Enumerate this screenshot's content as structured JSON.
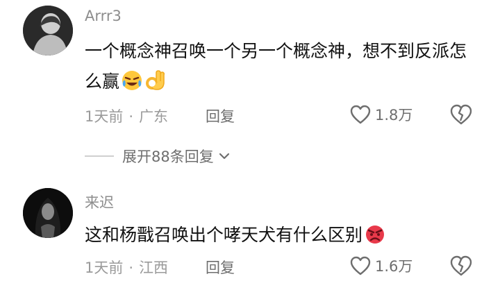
{
  "comments": [
    {
      "username": "Arrr3",
      "text": "一个概念神召唤一个另一个概念神，想不到反派怎么赢",
      "emojis": [
        "crying-laughing-emoji",
        "ok-hand-emoji"
      ],
      "time": "1天前",
      "separator": "·",
      "location": "广东",
      "reply_label": "回复",
      "like_count": "1.8万",
      "expand_replies": "展开88条回复"
    },
    {
      "username": "来迟",
      "text": "这和杨戬召唤出个哮天犬有什么区别",
      "emojis": [
        "angry-face-emoji"
      ],
      "time": "1天前",
      "separator": "·",
      "location": "江西",
      "reply_label": "回复",
      "like_count": "1.6万"
    }
  ],
  "icons": {
    "like": "heart-outline-icon",
    "dislike": "broken-heart-icon",
    "expand": "chevron-down-icon"
  },
  "colors": {
    "username": "#8d8d8d",
    "meta": "#9a9a9a",
    "action": "#6e6e6e",
    "text": "#111111"
  }
}
